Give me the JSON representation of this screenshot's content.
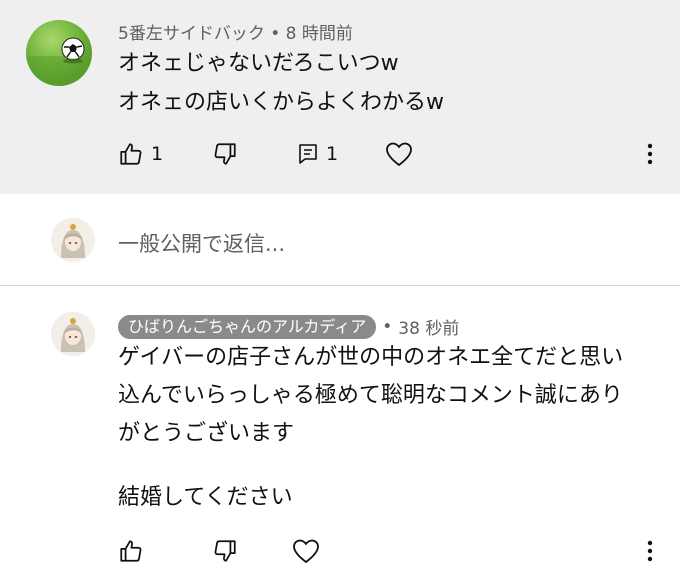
{
  "comment1": {
    "author": "5番左サイドバック",
    "separator": "•",
    "time": "8 時間前",
    "lines": [
      "オネェじゃないだろこいつw",
      "オネェの店いくからよくわかるw"
    ],
    "like_count": "1",
    "reply_count": "1"
  },
  "reply_box": {
    "placeholder": "一般公開で返信..."
  },
  "comment2": {
    "author": "ひばりんごちゃんのアルカディア",
    "separator": "•",
    "time": "38 秒前",
    "lines": [
      "ゲイバーの店子さんが世の中のオネエ全てだと思い",
      "込んでいらっしゃる極めて聡明なコメント誠にあり",
      "がとうございます",
      "結婚してください"
    ]
  },
  "colors": {
    "top_background": "#efefef",
    "chip_background": "#8a8a8a",
    "meta_text": "#606060"
  }
}
